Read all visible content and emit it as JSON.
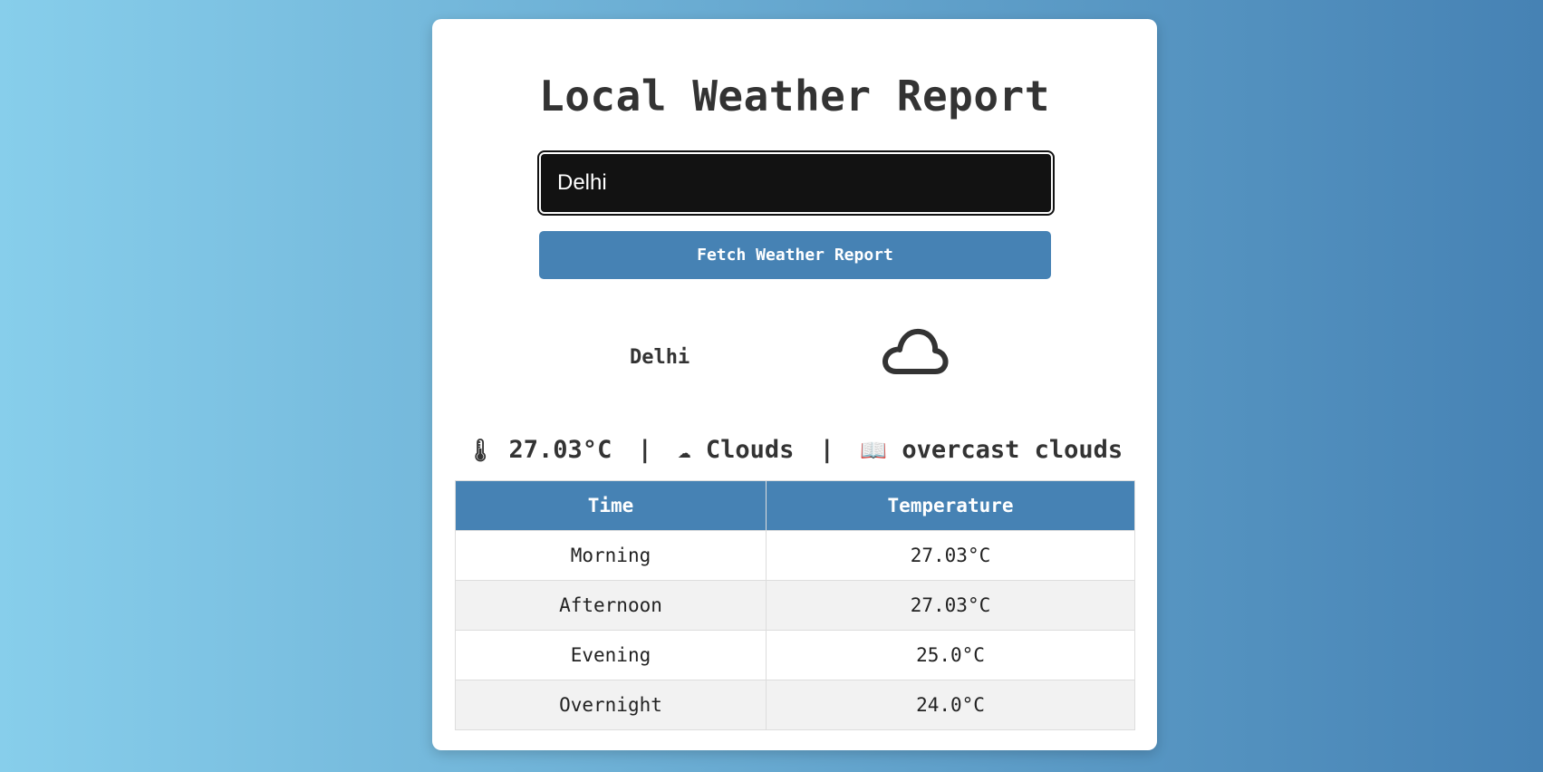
{
  "header": {
    "title": "Local Weather Report"
  },
  "search": {
    "value": "Delhi",
    "button_label": "Fetch Weather Report"
  },
  "current": {
    "city": "Delhi",
    "icon": "cloud-icon",
    "temp_emoji": "🌡",
    "temperature": "27.03°C",
    "separator": "|",
    "condition_emoji": "☁",
    "condition": "Clouds",
    "description_emoji": "📖",
    "description": "overcast clouds"
  },
  "forecast": {
    "headers": [
      "Time",
      "Temperature"
    ],
    "rows": [
      {
        "time": "Morning",
        "temp": "27.03°C"
      },
      {
        "time": "Afternoon",
        "temp": "27.03°C"
      },
      {
        "time": "Evening",
        "temp": "25.0°C"
      },
      {
        "time": "Overnight",
        "temp": "24.0°C"
      }
    ]
  },
  "colors": {
    "accent": "#4682b4",
    "input_bg": "#121212",
    "text": "#333333",
    "gradient_start": "#87ceeb",
    "gradient_end": "#4682b4"
  }
}
